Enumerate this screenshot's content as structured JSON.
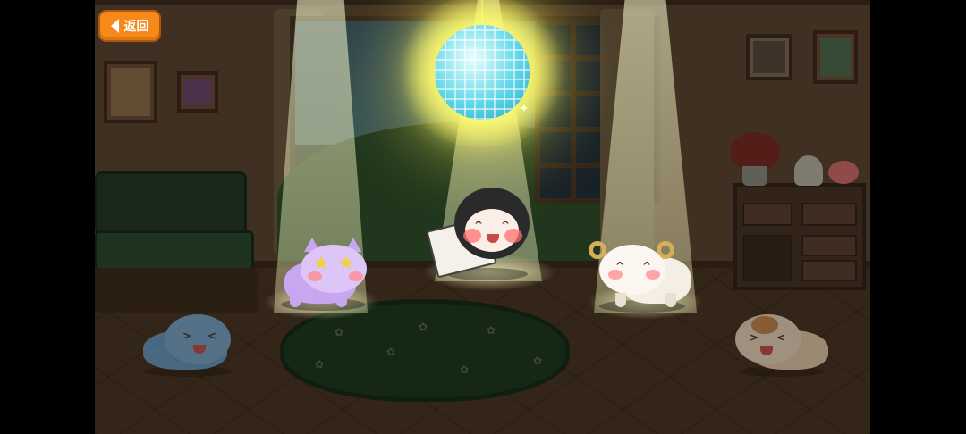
{
  "back_button": {
    "label": "返回",
    "icon": "back-arrow-icon",
    "color": "#f58a1a"
  },
  "scene": {
    "name": "living-room-dance-party",
    "props": [
      "mirror-ball-icon",
      "sofa",
      "cabinet",
      "window",
      "rug",
      "picture-frames",
      "flower-vase",
      "teapot"
    ],
    "mirror_ball_color": "#5ed6e8",
    "spotlight_color": "#fffbd0"
  },
  "characters": [
    {
      "name": "purple-cat",
      "color": "#c9a7f0",
      "expression": "star-eyes",
      "spotlit": true
    },
    {
      "name": "black-hooded-cat",
      "color": "#2a2a2a",
      "expression": "happy",
      "holding": "card",
      "spotlit": true
    },
    {
      "name": "white-sheep",
      "color": "#f4eee4",
      "expression": "smiling",
      "spotlit": true
    },
    {
      "name": "blue-cat",
      "color": "#5ba0d8",
      "expression": "laughing",
      "spotlit": false
    },
    {
      "name": "calico-cat",
      "color": "#f2dcc0",
      "expression": "laughing",
      "spotlit": false
    }
  ]
}
